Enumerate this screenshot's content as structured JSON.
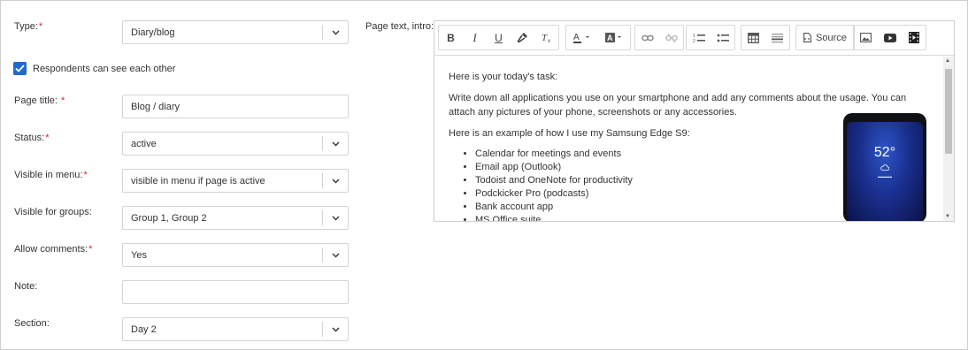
{
  "form": {
    "type": {
      "label": "Type:",
      "required": "*",
      "value": "Diary/blog"
    },
    "respondents_see": {
      "label": "Respondents can see each other",
      "checked": true
    },
    "page_title": {
      "label": "Page title:",
      "required": "*",
      "value": "Blog / diary"
    },
    "status": {
      "label": "Status:",
      "required": "*",
      "value": "active"
    },
    "visible_in_menu": {
      "label": "Visible in menu:",
      "required": "*",
      "value": "visible in menu if page is active"
    },
    "visible_for_groups": {
      "label": "Visible for groups:",
      "value": "Group 1, Group 2"
    },
    "allow_comments": {
      "label": "Allow comments:",
      "required": "*",
      "value": "Yes"
    },
    "note": {
      "label": "Note:",
      "value": ""
    },
    "section": {
      "label": "Section:",
      "value": "Day 2"
    }
  },
  "editor": {
    "label": "Page text, intro:",
    "required": "*",
    "toolbar": {
      "source_label": "Source"
    },
    "content": {
      "p1": "Here is your today's task:",
      "p2": "Write down all applications you use on your smartphone and add any comments about the usage. You can attach any pictures of your phone, screenshots or any accessories.",
      "p3": "Here is an example of how I use my Samsung Edge S9:",
      "items": [
        "Calendar for meetings and events",
        "Email app (Outlook)",
        "Todoist and OneNote for productivity",
        "Podckicker Pro (podcasts)",
        "Bank account app",
        "MS Office suite"
      ],
      "phone_temp": "52°"
    }
  },
  "colors": {
    "accent": "#1f6bd1",
    "required": "#d9262b"
  }
}
